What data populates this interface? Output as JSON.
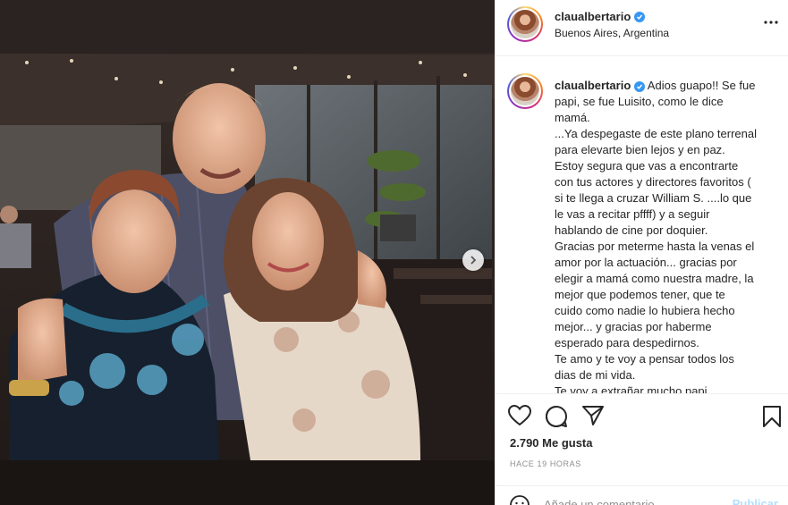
{
  "post": {
    "username": "claualbertario",
    "location": "Buenos Aires, Argentina",
    "caption_lines": [
      "Adios guapo!! Se fue",
      "papi, se fue Luisito, como le dice",
      "mamá.",
      "...Ya despegaste de este plano terrenal",
      "para elevarte bien lejos y en paz.",
      "Estoy segura que vas a encontrarte",
      "con tus actores y directores favoritos (",
      "si te llega a cruzar William S. ....lo que",
      "le vas a recitar pffff) y a seguir",
      "hablando de cine por doquier.",
      "Gracias por meterme hasta la venas el",
      "amor por la actuación... gracias por",
      "elegir a mamá como nuestra madre, la",
      "mejor que podemos tener, que te",
      "cuido como nadie lo hubiera hecho",
      "mejor... y gracias por haberme",
      "esperado para despedirnos.",
      "Te amo y te voy a pensar todos los",
      "dias de mi vida.",
      "Te voy a extrañar mucho papi"
    ],
    "likes": "2.790 Me gusta",
    "time": "HACE 19 HORAS",
    "comment_placeholder": "Añade un comentario...",
    "publish_label": "Publicar"
  },
  "icons": {
    "verified": "verified-badge-icon",
    "more": "more-options-icon",
    "like": "heart-icon",
    "comment": "comment-icon",
    "share": "paper-plane-icon",
    "save": "bookmark-icon",
    "next": "chevron-right-icon",
    "emoji": "smiley-icon"
  },
  "colors": {
    "verified": "#3897f0",
    "muted": "#8e8e8e",
    "publish_disabled": "#b2dffc",
    "border": "#efefef"
  }
}
